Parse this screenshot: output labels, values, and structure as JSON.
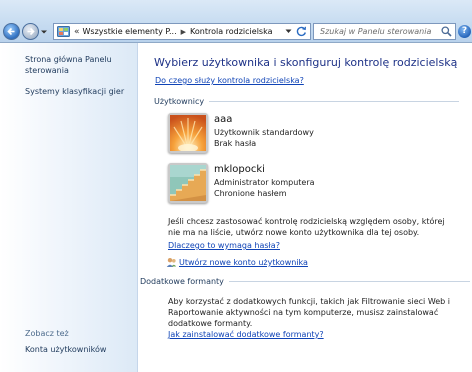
{
  "address_bar": {
    "overflow_marker": "«",
    "crumbs": [
      "Wszystkie elementy P...",
      "Kontrola rodzicielska"
    ]
  },
  "search": {
    "placeholder": "Szukaj w Panelu sterowania"
  },
  "help_label": "?",
  "sidebar": {
    "items": [
      {
        "label": "Strona główna Panelu\nsterowania"
      },
      {
        "label": "Systemy klasyfikacji gier"
      }
    ],
    "see_also_heading": "Zobacz też",
    "see_also": [
      {
        "label": "Konta użytkowników"
      }
    ]
  },
  "main": {
    "title": "Wybierz użytkownika i skonfiguruj kontrolę rodzicielską",
    "help_link": "Do czego służy kontrola rodzicielska?",
    "users_heading": "Użytkownicy",
    "users": [
      {
        "name": "aaa",
        "role": "Użytkownik standardowy",
        "password_status": "Brak hasła",
        "avatar": "flower-avatar"
      },
      {
        "name": "mklopocki",
        "role": "Administrator komputera",
        "password_status": "Chronione hasłem",
        "avatar": "stairs-avatar"
      }
    ],
    "info_text": "Jeśli chcesz zastosować kontrolę rodzicielską względem osoby, której nie ma na liście, utwórz nowe konto użytkownika dla tej osoby.",
    "why_password_link": "Dlaczego to wymaga hasła?",
    "create_account_link": "Utwórz nowe konto użytkownika",
    "extras_heading": "Dodatkowe formanty",
    "extras_text": "Aby korzystać z dodatkowych funkcji, takich jak Filtrowanie sieci Web i Raportowanie aktywności na tym komputerze, musisz zainstalować dodatkowe formanty.",
    "install_link": "Jak zainstalować dodatkowe formanty?"
  },
  "colors": {
    "title": "#1e3287",
    "link": "#0f43b6",
    "sidebar_link": "#1e395b"
  }
}
